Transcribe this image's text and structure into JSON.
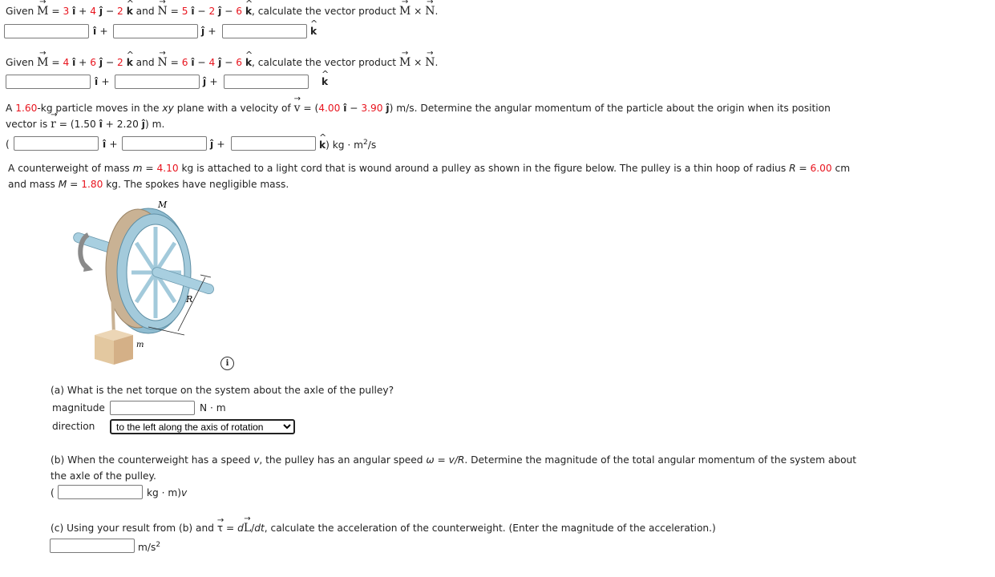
{
  "q1": {
    "prefix": "Given ",
    "M_label": "M",
    "eq": " = ",
    "m_i": "3",
    "m_j": "4",
    "m_k": "2",
    "and": " and ",
    "N_label": "N",
    "n_i": "5",
    "n_j": "2",
    "n_k": "6",
    "suffix": ", calculate the vector product ",
    "cross": " × ",
    "period": ".",
    "inputs": [
      "",
      "",
      ""
    ]
  },
  "q2": {
    "prefix": "Given ",
    "M_label": "M",
    "eq": " = ",
    "m_i": "4",
    "m_j": "6",
    "m_k": "2",
    "and": " and ",
    "N_label": "N",
    "n_i": "6",
    "n_j": "4",
    "n_k": "6",
    "suffix": ", calculate the vector product ",
    "cross": " × ",
    "period": ".",
    "inputs": [
      "",
      "",
      ""
    ]
  },
  "q3": {
    "t1": "A ",
    "mass": "1.60",
    "t2": "-kg particle moves in the ",
    "xy": "xy",
    "t3": " plane with a velocity of ",
    "v_label": "v",
    "t4": " = (",
    "vx": "4.00",
    "t5": " − ",
    "vy": "3.90",
    "t6": ") m/s. Determine the angular momentum of the particle about the origin when its position",
    "t7": "vector is ",
    "r_label": "r",
    "t8": " = (1.50 ",
    "t9": " + 2.20 ",
    "t10": ") m.",
    "open_paren": "(",
    "unit_suffix": ") kg · m",
    "unit_exp": "2",
    "unit_end": "/s",
    "inputs": [
      "",
      "",
      ""
    ]
  },
  "q4": {
    "t1": "A counterweight of mass ",
    "m_sym": "m",
    "t2": " = ",
    "m_val": "4.10",
    "t3": " kg is attached to a light cord that is wound around a pulley as shown in the figure below. The pulley is a thin hoop of radius ",
    "R_sym": "R",
    "t4": " = ",
    "R_val": "6.00",
    "t5": " cm",
    "t6": "and mass ",
    "M_sym": "M",
    "t7": " = ",
    "M_val": "1.80",
    "t8": " kg. The spokes have negligible mass.",
    "figure": {
      "label_M": "M",
      "label_R": "R",
      "label_m": "m",
      "info_icon": "i"
    },
    "part_a": {
      "question": "(a) What is the net torque on the system about the axle of the pulley?",
      "magnitude_label": "magnitude",
      "magnitude_value": "",
      "magnitude_unit": "N · m",
      "direction_label": "direction",
      "direction_selected": "to the left along the axis of rotation"
    },
    "part_b": {
      "t1": "(b) When the counterweight has a speed ",
      "v": "v",
      "t2": ", the pulley has an angular speed ",
      "omega": "ω",
      "t3": " = ",
      "vR": "v/R",
      "t4": ". Determine the magnitude of the total angular momentum of the system about",
      "t5": "the axle of the pulley.",
      "open_paren": "(",
      "value": "",
      "unit": "kg · m)",
      "unit_v": "v"
    },
    "part_c": {
      "t1": "(c) Using your result from (b) and ",
      "tau": "τ",
      "t2": " = ",
      "d": "d",
      "L": "L",
      "t3": "/",
      "dt": "dt",
      "t4": ", calculate the acceleration of the counterweight. (Enter the magnitude of the acceleration.)",
      "value": "",
      "unit": "m/s",
      "unit_exp": "2"
    }
  }
}
